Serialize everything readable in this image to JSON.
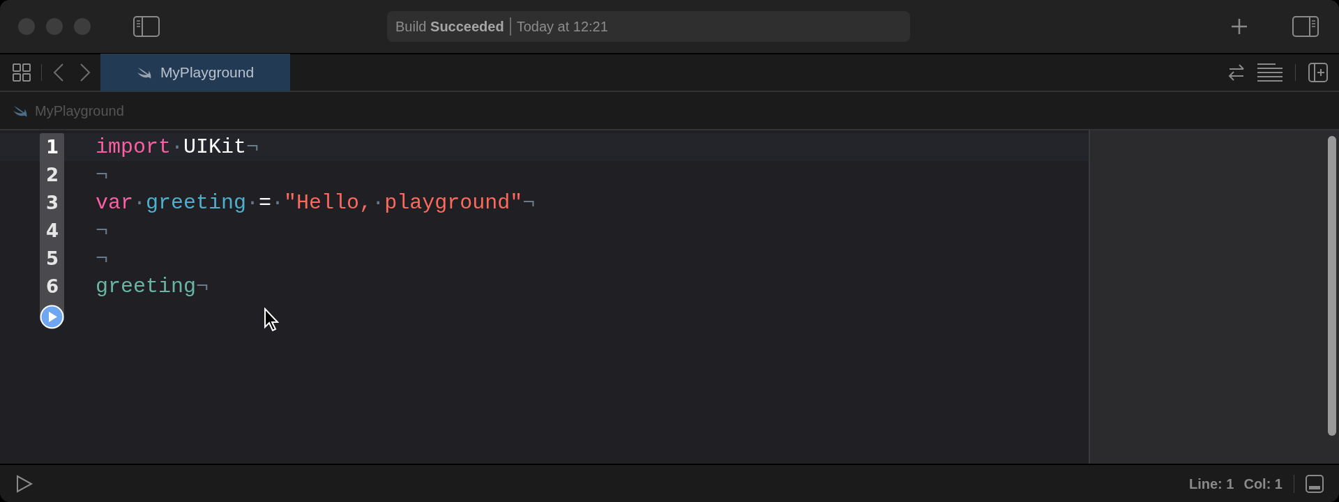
{
  "window": {
    "status": {
      "action": "Build",
      "result": "Succeeded",
      "time": "Today at 12:21"
    }
  },
  "tabs": [
    {
      "label": "MyPlayground",
      "selected": true
    }
  ],
  "breadcrumb": [
    "MyPlayground"
  ],
  "editor": {
    "lines": [
      {
        "number": "1",
        "selected": true,
        "tokens": [
          {
            "kind": "keyword",
            "text": "import"
          },
          {
            "kind": "space",
            "text": "·"
          },
          {
            "kind": "plain",
            "text": "UIKit"
          },
          {
            "kind": "eol",
            "text": "¬"
          }
        ]
      },
      {
        "number": "2",
        "selected": false,
        "tokens": [
          {
            "kind": "eol",
            "text": "¬"
          }
        ]
      },
      {
        "number": "3",
        "selected": false,
        "tokens": [
          {
            "kind": "keyword",
            "text": "var"
          },
          {
            "kind": "space",
            "text": "·"
          },
          {
            "kind": "declaration",
            "text": "greeting"
          },
          {
            "kind": "space",
            "text": "·"
          },
          {
            "kind": "plain",
            "text": "="
          },
          {
            "kind": "space",
            "text": "·"
          },
          {
            "kind": "string",
            "text": "\"Hello,"
          },
          {
            "kind": "space",
            "text": "·"
          },
          {
            "kind": "string",
            "text": "playground\""
          },
          {
            "kind": "eol",
            "text": "¬"
          }
        ]
      },
      {
        "number": "4",
        "selected": false,
        "tokens": [
          {
            "kind": "eol",
            "text": "¬"
          }
        ]
      },
      {
        "number": "5",
        "selected": false,
        "tokens": [
          {
            "kind": "eol",
            "text": "¬"
          }
        ]
      },
      {
        "number": "6",
        "selected": false,
        "tokens": [
          {
            "kind": "reference",
            "text": "greeting"
          },
          {
            "kind": "eol",
            "text": "¬"
          }
        ]
      }
    ]
  },
  "status_bar": {
    "line": "Line: 1",
    "column": "Col: 1"
  }
}
